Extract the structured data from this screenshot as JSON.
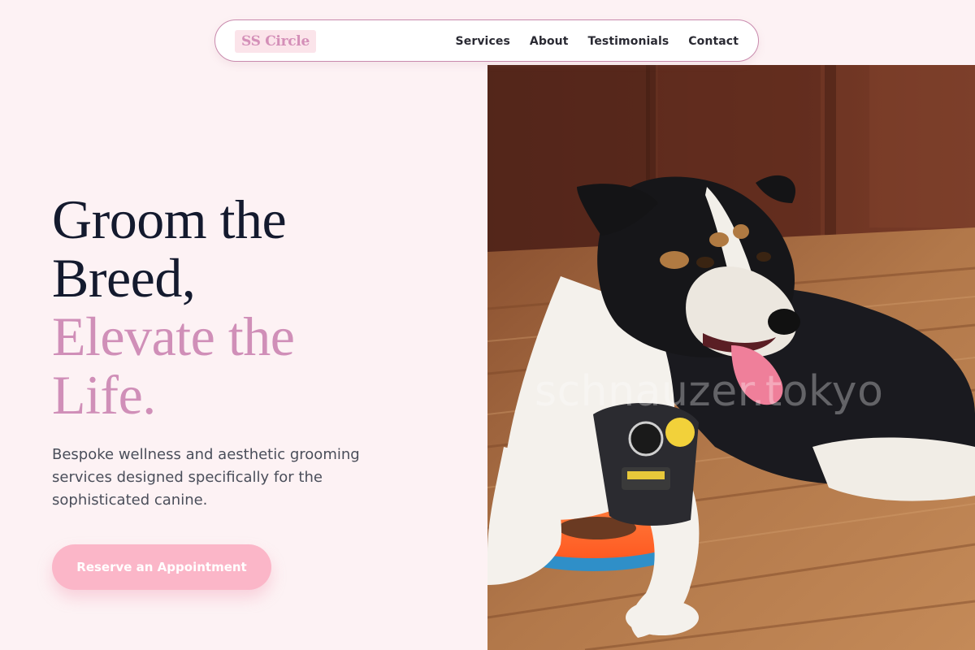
{
  "brand": {
    "name": "SS Circle"
  },
  "nav": {
    "links": [
      "Services",
      "About",
      "Testimonials",
      "Contact"
    ]
  },
  "hero": {
    "headline_line1": "Groom the",
    "headline_line2": "Breed,",
    "headline_accent_line1": "Elevate the",
    "headline_accent_line2": "Life.",
    "subtext": "Bespoke wellness and aesthetic grooming services designed specifically for the sophisticated canine.",
    "cta_label": "Reserve an Appointment",
    "image_watermark": "schnauzer.tokyo"
  },
  "colors": {
    "background": "#fdf2f4",
    "accent_pink": "#d08fb8",
    "button_pink": "#fbb6c8",
    "headline_dark": "#141a2e",
    "body_text": "#4a4e5a"
  }
}
